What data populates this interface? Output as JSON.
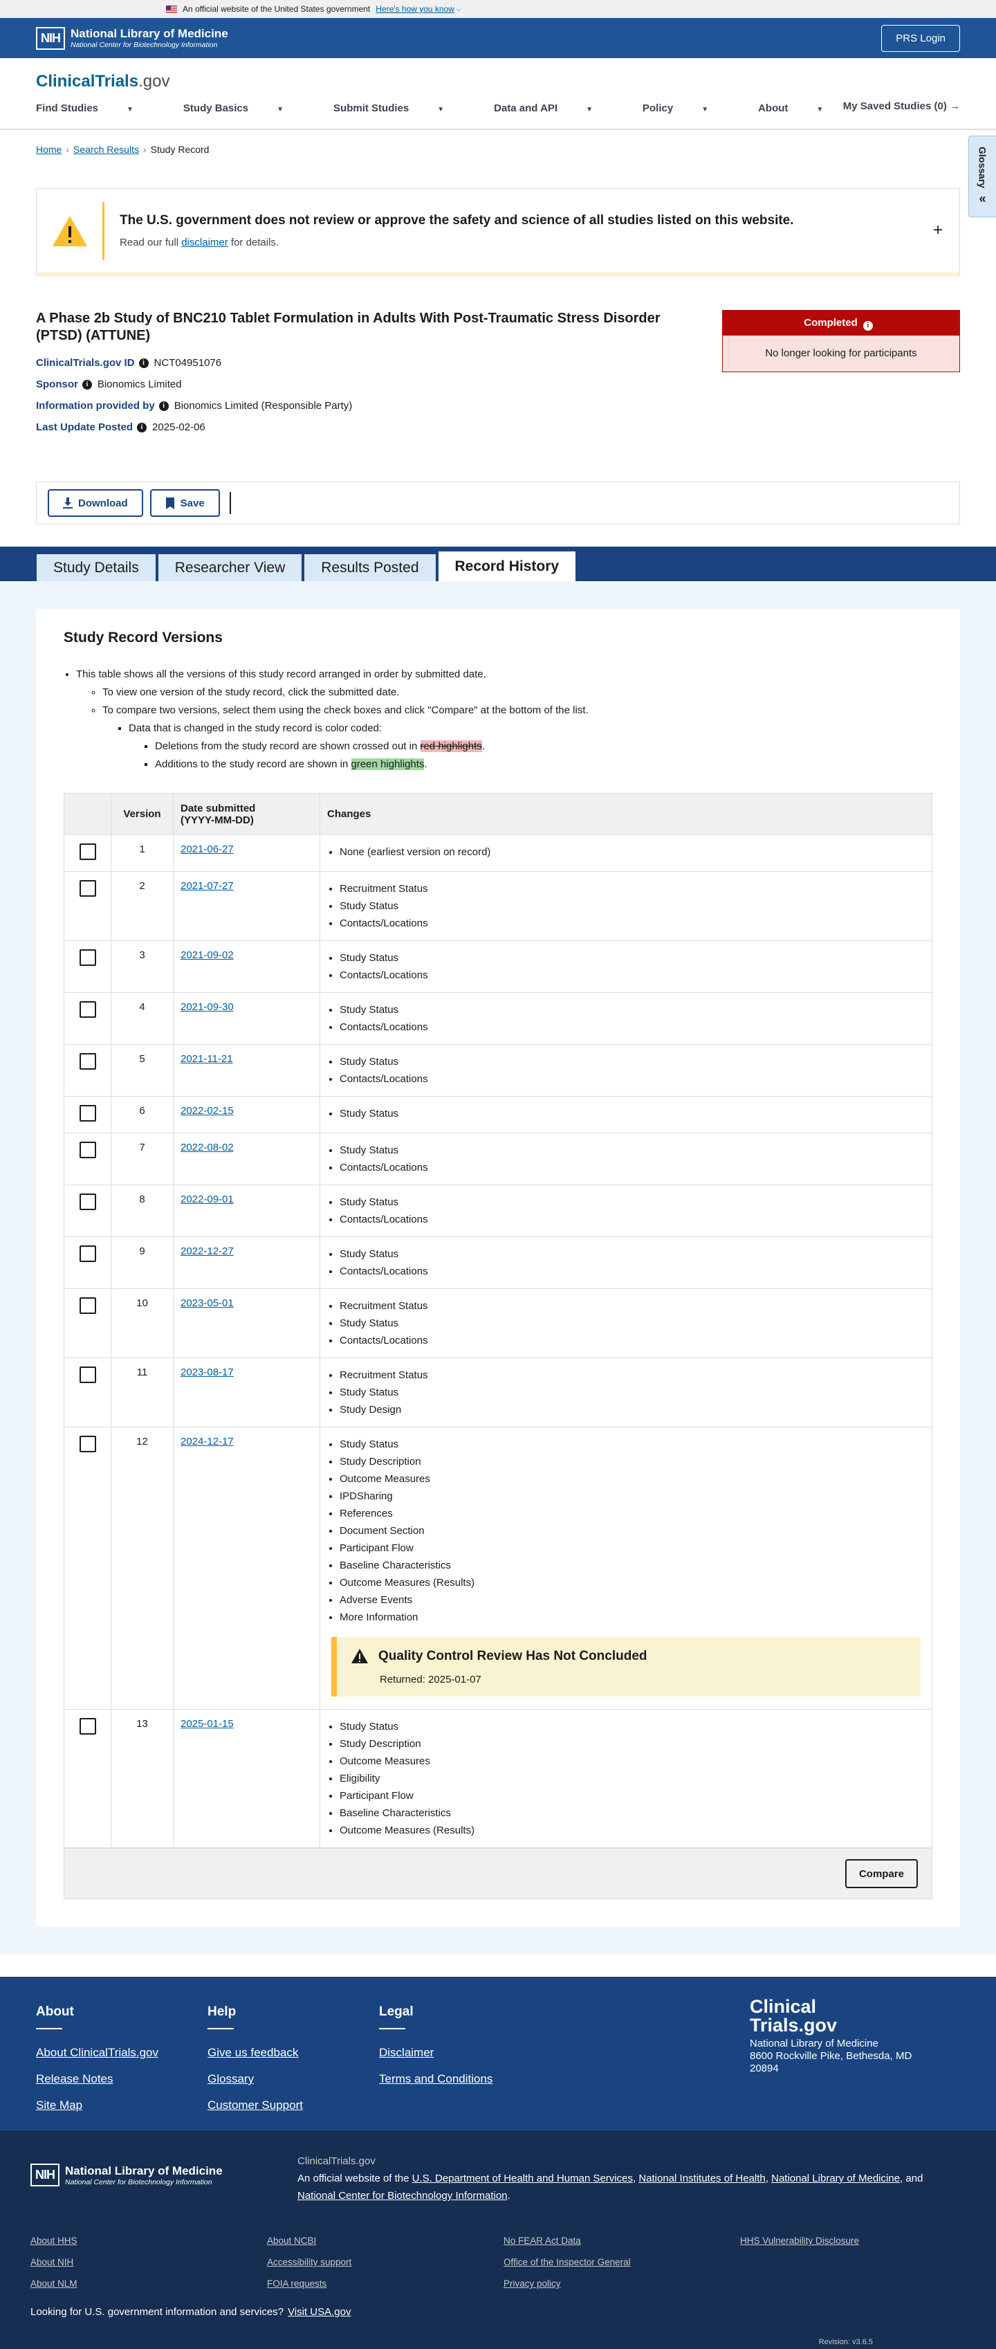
{
  "gov_banner": {
    "text": "An official website of the United States government",
    "how": "Here's how you know"
  },
  "nih": {
    "box": "NIH",
    "name": "National Library of Medicine",
    "sub": "National Center for Biotechnology Information",
    "prs": "PRS Login"
  },
  "header": {
    "logo_main": "ClinicalTrials",
    "logo_dot": ".gov",
    "saved": "My Saved Studies (0)"
  },
  "nav": [
    {
      "label": "Find Studies"
    },
    {
      "label": "Study Basics"
    },
    {
      "label": "Submit Studies"
    },
    {
      "label": "Data and API"
    },
    {
      "label": "Policy"
    },
    {
      "label": "About"
    }
  ],
  "glossary": "Glossary",
  "breadcrumb": {
    "home": "Home",
    "results": "Search Results",
    "current": "Study Record"
  },
  "alert": {
    "title": "The U.S. government does not review or approve the safety and science of all studies listed on this website.",
    "pre": "Read our full ",
    "link": "disclaimer",
    "post": " for details."
  },
  "study": {
    "title": "A Phase 2b Study of BNC210 Tablet Formulation in Adults With Post-Traumatic Stress Disorder (PTSD) (ATTUNE)",
    "id_label": "ClinicalTrials.gov ID",
    "id": "NCT04951076",
    "sponsor_label": "Sponsor",
    "sponsor": "Bionomics Limited",
    "provided_label": "Information provided by",
    "provided": "Bionomics Limited (Responsible Party)",
    "updated_label": "Last Update Posted",
    "updated": "2025-02-06",
    "status": "Completed",
    "status_sub": "No longer looking for participants"
  },
  "actions": {
    "download": "Download",
    "save": "Save"
  },
  "tabs": [
    {
      "label": "Study Details"
    },
    {
      "label": "Researcher View"
    },
    {
      "label": "Results Posted"
    },
    {
      "label": "Record History"
    }
  ],
  "versions": {
    "heading": "Study Record Versions",
    "intro": "This table shows all the versions of this study record arranged in order by submitted date.",
    "view": "To view one version of the study record, click the submitted date.",
    "compare": "To compare two versions, select them using the check boxes and click \"Compare\" at the bottom of the list.",
    "color": "Data that is changed in the study record is color coded:",
    "del_pre": "Deletions from the study record are shown crossed out in ",
    "del_hl": "red highlights",
    "del_post": ".",
    "add_pre": "Additions to the study record are shown in ",
    "add_hl": "green highlights",
    "add_post": ".",
    "col_version": "Version",
    "col_date_1": "Date submitted",
    "col_date_2": "(YYYY-MM-DD)",
    "col_changes": "Changes",
    "rows": [
      {
        "v": "1",
        "d": "2021-06-27",
        "c": [
          "None (earliest version on record)"
        ]
      },
      {
        "v": "2",
        "d": "2021-07-27",
        "c": [
          "Recruitment Status",
          "Study Status",
          "Contacts/Locations"
        ]
      },
      {
        "v": "3",
        "d": "2021-09-02",
        "c": [
          "Study Status",
          "Contacts/Locations"
        ]
      },
      {
        "v": "4",
        "d": "2021-09-30",
        "c": [
          "Study Status",
          "Contacts/Locations"
        ]
      },
      {
        "v": "5",
        "d": "2021-11-21",
        "c": [
          "Study Status",
          "Contacts/Locations"
        ]
      },
      {
        "v": "6",
        "d": "2022-02-15",
        "c": [
          "Study Status"
        ]
      },
      {
        "v": "7",
        "d": "2022-08-02",
        "c": [
          "Study Status",
          "Contacts/Locations"
        ]
      },
      {
        "v": "8",
        "d": "2022-09-01",
        "c": [
          "Study Status",
          "Contacts/Locations"
        ]
      },
      {
        "v": "9",
        "d": "2022-12-27",
        "c": [
          "Study Status",
          "Contacts/Locations"
        ]
      },
      {
        "v": "10",
        "d": "2023-05-01",
        "c": [
          "Recruitment Status",
          "Study Status",
          "Contacts/Locations"
        ]
      },
      {
        "v": "11",
        "d": "2023-08-17",
        "c": [
          "Recruitment Status",
          "Study Status",
          "Study Design"
        ]
      },
      {
        "v": "12",
        "d": "2024-12-17",
        "c": [
          "Study Status",
          "Study Description",
          "Outcome Measures",
          "IPDSharing",
          "References",
          "Document Section",
          "Participant Flow",
          "Baseline Characteristics",
          "Outcome Measures (Results)",
          "Adverse Events",
          "More Information"
        ],
        "qc": {
          "title": "Quality Control Review Has Not Concluded",
          "returned": "Returned: 2025-01-07"
        }
      },
      {
        "v": "13",
        "d": "2025-01-15",
        "c": [
          "Study Status",
          "Study Description",
          "Outcome Measures",
          "Eligibility",
          "Participant Flow",
          "Baseline Characteristics",
          "Outcome Measures (Results)"
        ]
      }
    ],
    "compare_btn": "Compare"
  },
  "footer": {
    "about": {
      "h": "About",
      "links": [
        "About ClinicalTrials.gov",
        "Release Notes",
        "Site Map"
      ]
    },
    "help": {
      "h": "Help",
      "links": [
        "Give us feedback",
        "Glossary",
        "Customer Support"
      ]
    },
    "legal": {
      "h": "Legal",
      "links": [
        "Disclaimer",
        "Terms and Conditions"
      ]
    },
    "logo_1": "Clinical",
    "logo_2": "Trials.gov",
    "address_1": "National Library of Medicine",
    "address_2": "8600 Rockville Pike, Bethesda, MD",
    "address_3": "20894"
  },
  "footer2": {
    "site": "ClinicalTrials.gov",
    "official_pre": "An official website of the ",
    "hhs": "U.S. Department of Health and Human Services",
    "nih": "National Institutes of Health",
    "nlm": "National Library of Medicine",
    "ncbi": "National Center for Biotechnology Information",
    "sep": ", ",
    "and": ", and ",
    "end": ".",
    "col1": [
      "About HHS",
      "About NIH",
      "About NLM"
    ],
    "col2": [
      "About NCBI",
      "Accessibility support",
      "FOIA requests"
    ],
    "col3": [
      "No FEAR Act Data",
      "Office of the Inspector General",
      "Privacy policy"
    ],
    "col4": [
      "HHS Vulnerability Disclosure"
    ],
    "usa_pre": "Looking for U.S. government information and services?",
    "usa_link": "Visit USA.gov",
    "revision": "Revision: v3.6.5"
  }
}
